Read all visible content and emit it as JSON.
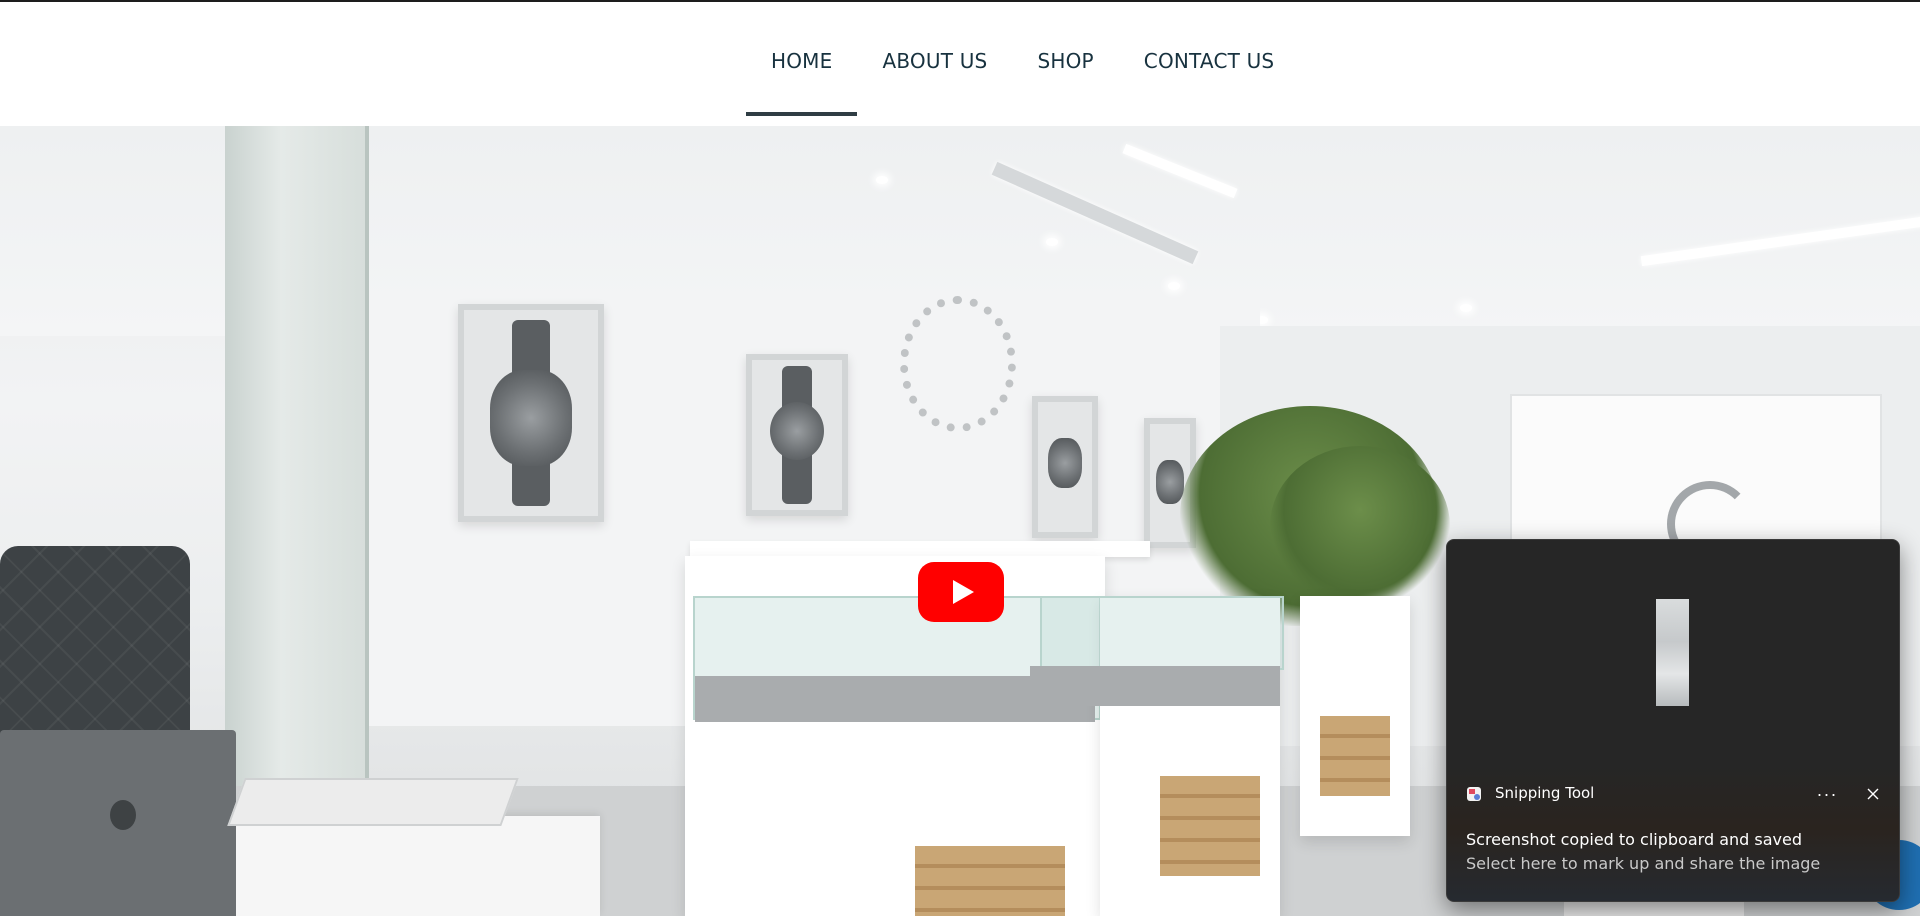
{
  "nav": {
    "items": [
      {
        "label": "HOME",
        "active": true
      },
      {
        "label": "ABOUT US",
        "active": false
      },
      {
        "label": "SHOP",
        "active": false
      },
      {
        "label": "CONTACT US",
        "active": false
      }
    ]
  },
  "hero": {
    "play_button_color": "#ff0000"
  },
  "toast": {
    "app_name": "Snipping Tool",
    "more_label": "···",
    "title": "Screenshot copied to clipboard and saved",
    "body": "Select here to mark up and share the image"
  },
  "colors": {
    "nav_text": "#18323f",
    "nav_active_underline": "#2f3d44",
    "toast_bg": "#262626"
  }
}
